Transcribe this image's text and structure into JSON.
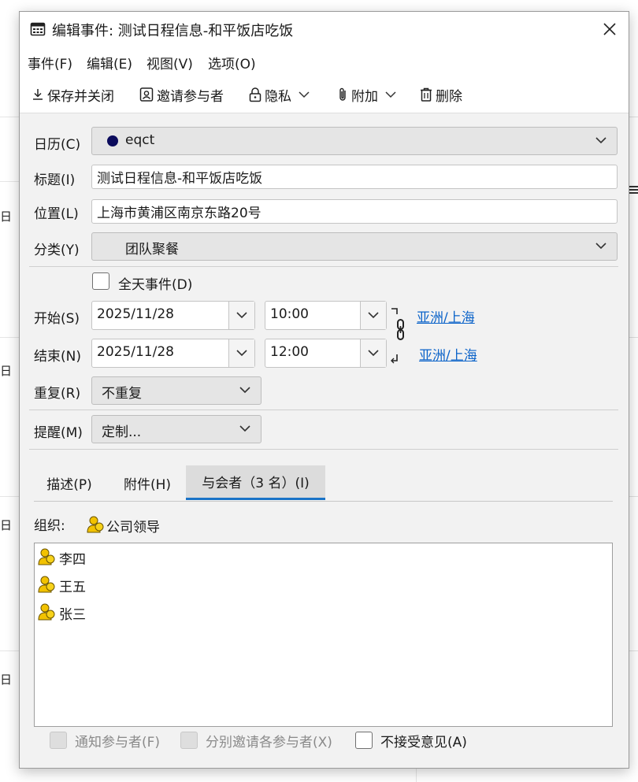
{
  "background": {
    "day_char": "日"
  },
  "window": {
    "title": "编辑事件: 测试日程信息-和平饭店吃饭",
    "close_label": "×"
  },
  "menu": {
    "items": [
      "事件(F)",
      "编辑(E)",
      "视图(V)",
      "选项(O)"
    ]
  },
  "toolbar": {
    "save_close": "保存并关闭",
    "invite": "邀请参与者",
    "privacy": "隐私",
    "attach": "附加",
    "delete": "删除"
  },
  "form": {
    "calendar_label": "日历(C)",
    "calendar_value": "eqct",
    "calendar_color": "#0b0b5c",
    "title_label": "标题(I)",
    "title_value": "测试日程信息-和平饭店吃饭",
    "location_label": "位置(L)",
    "location_value": "上海市黄浦区南京东路20号",
    "category_label": "分类(Y)",
    "category_value": "团队聚餐",
    "allday_label": "全天事件(D)",
    "allday_checked": false,
    "start_label": "开始(S)",
    "start_date": "2025/11/28",
    "start_time": "10:00",
    "start_tz": "亚洲/上海",
    "end_label": "结束(N)",
    "end_date": "2025/11/28",
    "end_time": "12:00",
    "end_tz": "亚洲/上海",
    "repeat_label": "重复(R)",
    "repeat_value": "不重复",
    "reminder_label": "提醒(M)",
    "reminder_value": "定制..."
  },
  "tabs": {
    "desc": "描述(P)",
    "attach": "附件(H)",
    "attendees": "与会者（3 名）(I)",
    "active": "attendees"
  },
  "attendees": {
    "organizer_label": "组织:",
    "organizer": "公司领导",
    "list": [
      "李四",
      "王五",
      "张三"
    ]
  },
  "footer": {
    "notify": "通知参与者(F)",
    "separate": "分别邀请各参与者(X)",
    "no_counter": "不接受意见(A)"
  },
  "colors": {
    "link": "#0b63c9",
    "tab_accent": "#1a73c7",
    "person_icon": "#f2c200"
  }
}
